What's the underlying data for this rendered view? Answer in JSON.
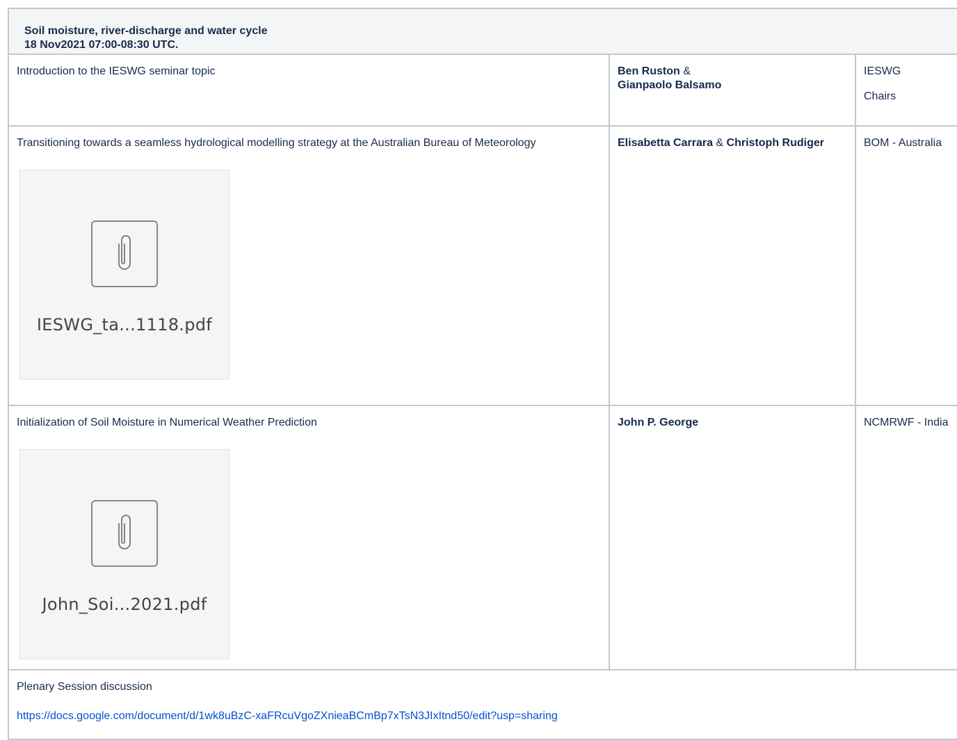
{
  "header": {
    "title": "Soil moisture, river-discharge and water cycle",
    "datetime": "18 Nov2021 07:00-08:30 UTC."
  },
  "rows": [
    {
      "topic": "Introduction to the IESWG seminar topic",
      "speaker1": "Ben Ruston",
      "amp": "&",
      "speaker2": "Gianpaolo Balsamo",
      "org_line1": "IESWG",
      "org_line2": "Chairs"
    },
    {
      "topic": "Transitioning towards a seamless hydrological modelling strategy at the Australian Bureau of Meteorology",
      "speaker1": "Elisabetta Carrara",
      "amp": "&",
      "speaker2": "Christoph Rudiger",
      "org": "BOM - Australia",
      "attachment": {
        "filename": "IESWG_ta...1118.pdf",
        "icon": "paperclip-icon"
      }
    },
    {
      "topic": "Initialization of Soil Moisture in Numerical Weather Prediction",
      "speaker": "John P. George",
      "org": "NCMRWF - India",
      "attachment": {
        "filename": "John_Soi...2021.pdf",
        "icon": "paperclip-icon"
      }
    }
  ],
  "plenary": {
    "text": "Plenary Session discussion",
    "link": "https://docs.google.com/document/d/1wk8uBzC-xaFRcuVgoZXnieaBCmBp7xTsN3JIxItnd50/edit?usp=sharing"
  },
  "colors": {
    "border": "#c1c7d0",
    "header_bg": "#f4f5f7",
    "link": "#0052cc"
  }
}
